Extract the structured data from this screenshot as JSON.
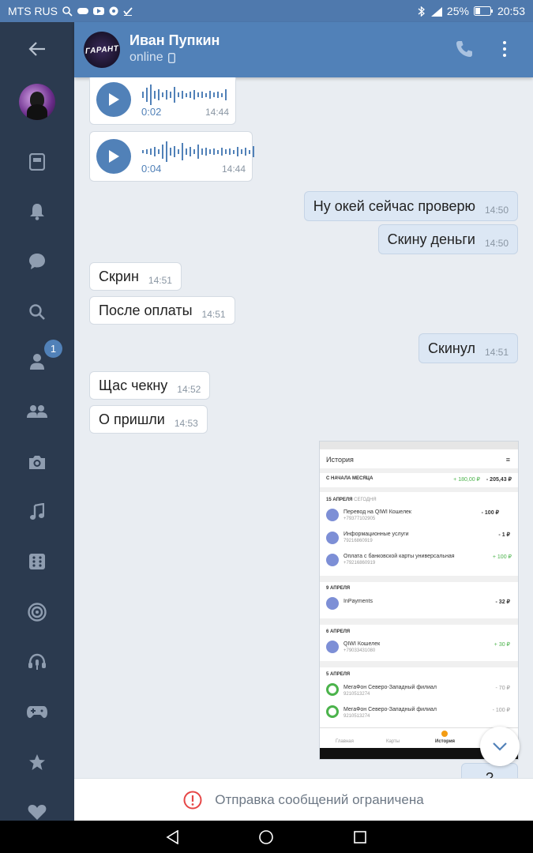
{
  "status_bar": {
    "carrier": "MTS RUS",
    "battery": "25%",
    "time": "20:53"
  },
  "header": {
    "avatar_text": "ГАРАНТ",
    "name": "Иван Пупкин",
    "status": "online"
  },
  "sidebar": {
    "friends_badge": "1"
  },
  "messages": {
    "voice1": {
      "duration": "0:02",
      "time": "14:44"
    },
    "voice2": {
      "duration": "0:04",
      "time": "14:44"
    },
    "m1": {
      "text": "Ну окей сейчас проверю",
      "time": "14:50"
    },
    "m2": {
      "text": "Скину деньги",
      "time": "14:50"
    },
    "m3": {
      "text": "Скрин",
      "time": "14:51"
    },
    "m4": {
      "text": "После оплаты",
      "time": "14:51"
    },
    "m5": {
      "text": "Скинул",
      "time": "14:51"
    },
    "m6": {
      "text": "Щас чекну",
      "time": "14:52"
    },
    "m7": {
      "text": "О пришли",
      "time": "14:53"
    },
    "m8": {
      "text": "?"
    }
  },
  "screenshot": {
    "title": "История",
    "period": "С НАЧАЛА МЕСЯЦА",
    "period_in": "+ 180,00 ₽",
    "period_out": "- 205,43 ₽",
    "d1": "15 АПРЕЛЯ",
    "d1_sub": "СЕГОДНЯ",
    "t1_name": "Перевод на QIWI Кошелек",
    "t1_sub": "+79377102905",
    "t1_amt": "- 100 ₽",
    "t2_name": "Информационные услуги",
    "t2_sub": "79216860919",
    "t2_amt": "- 1 ₽",
    "t3_name": "Оплата с банковской карты универсальная",
    "t3_sub": "+79216860919",
    "t3_amt": "+ 100 ₽",
    "d2": "9 АПРЕЛЯ",
    "t4_name": "InPayments",
    "t4_amt": "- 32 ₽",
    "d3": "6 АПРЕЛЯ",
    "t5_name": "QIWI Кошелек",
    "t5_sub": "+79033431080",
    "t5_amt": "+ 30 ₽",
    "d4": "5 АПРЕЛЯ",
    "t6_name": "МегаФон Северо-Западный филиал",
    "t6_sub": "9210513274",
    "t6_amt": "- 70 ₽",
    "t7_name": "МегаФон Северо-Западный филиал",
    "t7_sub": "9210513274",
    "t7_amt": "- 100 ₽",
    "tab1": "Главная",
    "tab2": "Карты",
    "tab3": "История"
  },
  "composer": {
    "notice": "Отправка сообщений ограничена"
  },
  "colors": {
    "accent": "#5181b8",
    "sidebar": "#2b3a4f",
    "incoming_green": "#4bb34b"
  }
}
